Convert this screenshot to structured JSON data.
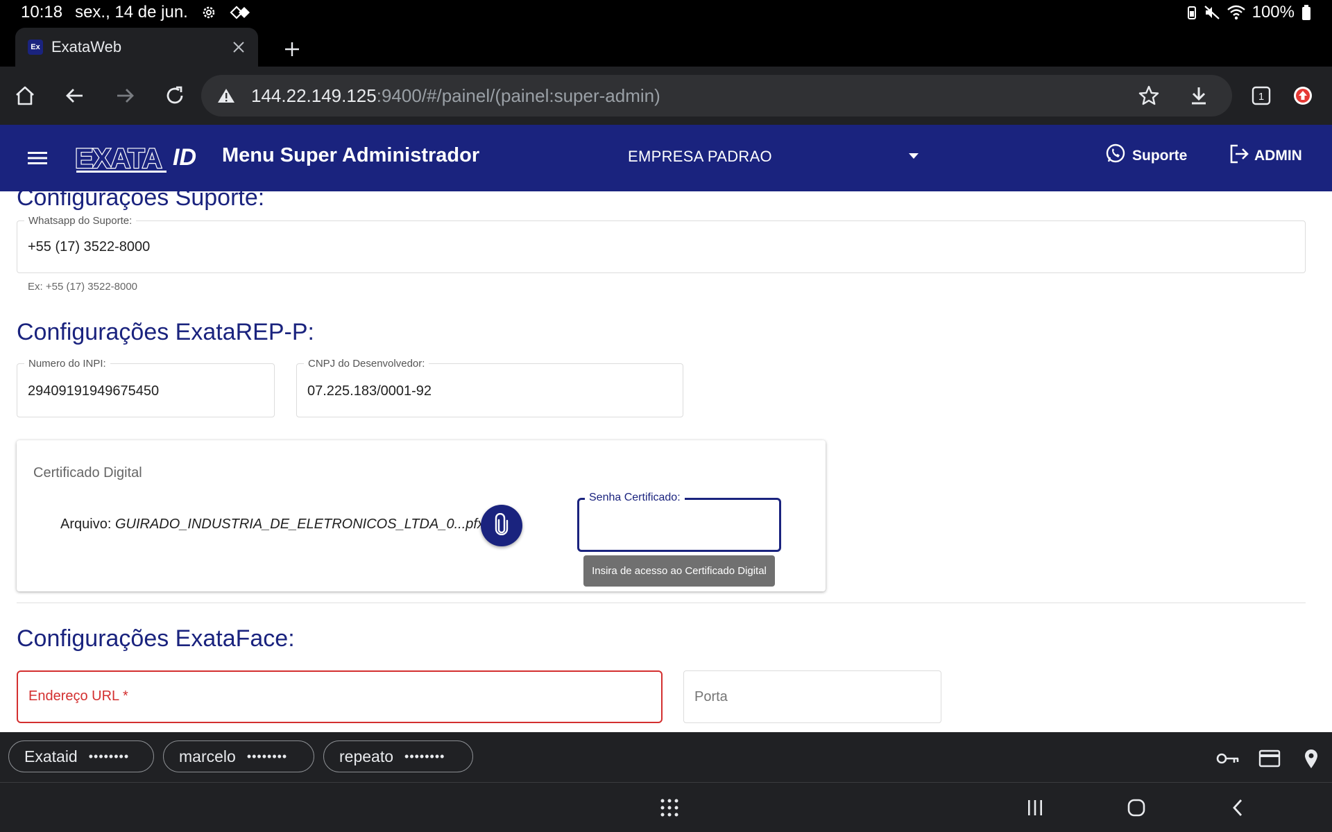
{
  "status_bar": {
    "time": "10:18",
    "date": "sex., 14 de jun.",
    "battery": "100%"
  },
  "browser": {
    "tab_title": "ExataWeb",
    "tab_favicon": "Ex",
    "url_host": "144.22.149.125",
    "url_rest": ":9400/#/painel/(painel:super-admin)",
    "tab_count": "1"
  },
  "app_header": {
    "logo_text": "EXATA",
    "logo_id": "ID",
    "title": "Menu Super Administrador",
    "company": "EMPRESA PADRAO",
    "support_label": "Suporte",
    "admin_label": "ADMIN"
  },
  "support_section": {
    "title": "Configurações Suporte:",
    "whatsapp_label": "Whatsapp do Suporte:",
    "whatsapp_value": "+55 (17) 3522-8000",
    "whatsapp_hint": "Ex: +55 (17) 3522-8000"
  },
  "rep_section": {
    "title": "Configurações ExataREP-P:",
    "inpi_label": "Numero do INPI:",
    "inpi_value": "29409191949675450",
    "cnpj_label": "CNPJ do Desenvolvedor:",
    "cnpj_value": "07.225.183/0001-92",
    "cert_title": "Certificado Digital",
    "file_label": "Arquivo:",
    "file_name": "GUIRADO_INDUSTRIA_DE_ELETRONICOS_LTDA_0...pfx",
    "password_label": "Senha Certificado:",
    "password_value": "",
    "password_tooltip": "Insira de acesso ao Certificado Digital"
  },
  "face_section": {
    "title": "Configurações ExataFace:",
    "url_placeholder": "Endereço URL *",
    "port_placeholder": "Porta"
  },
  "password_suggestions": [
    {
      "user": "Exataid",
      "mask": "••••••••"
    },
    {
      "user": "marcelo",
      "mask": "••••••••"
    },
    {
      "user": "repeato",
      "mask": "••••••••"
    }
  ],
  "colors": {
    "brand": "#1a237e",
    "error": "#d32f2f",
    "chrome_dark": "#202124"
  }
}
